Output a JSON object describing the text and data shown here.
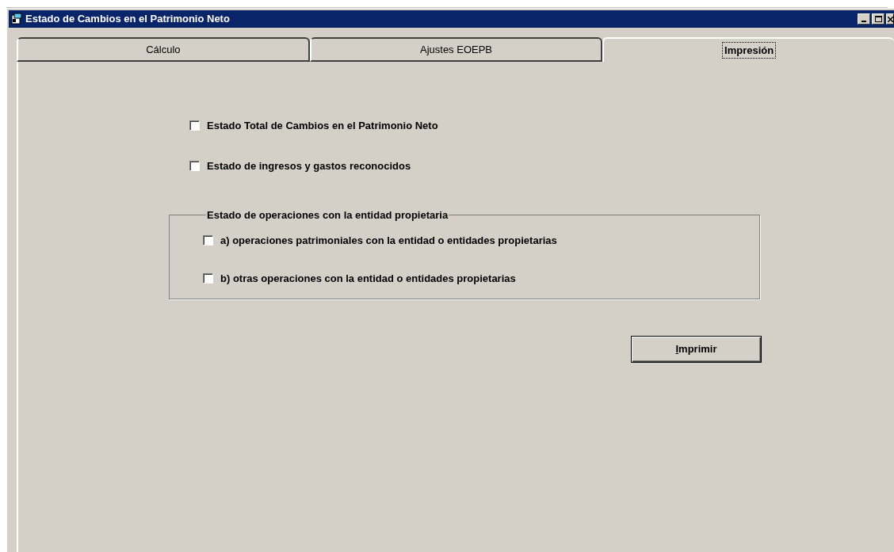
{
  "window": {
    "title": "Estado de Cambios en el Patrimonio Neto"
  },
  "tabs": [
    {
      "label": "Cálculo",
      "selected": false
    },
    {
      "label": "Ajustes EOEPB",
      "selected": false
    },
    {
      "label": "Impresión",
      "selected": true
    }
  ],
  "options": [
    {
      "label": "Estado Total de Cambios en el Patrimonio Neto",
      "checked": false
    },
    {
      "label": "Estado de ingresos y gastos reconocidos",
      "checked": false
    }
  ],
  "group": {
    "title": "Estado de operaciones con la entidad propietaria",
    "options": [
      {
        "label": "a) operaciones patrimoniales con la entidad o entidades propietarias",
        "checked": false
      },
      {
        "label": "b) otras operaciones con la entidad o entidades propietarias",
        "checked": false
      }
    ]
  },
  "print_button": {
    "label": "Imprimir"
  }
}
